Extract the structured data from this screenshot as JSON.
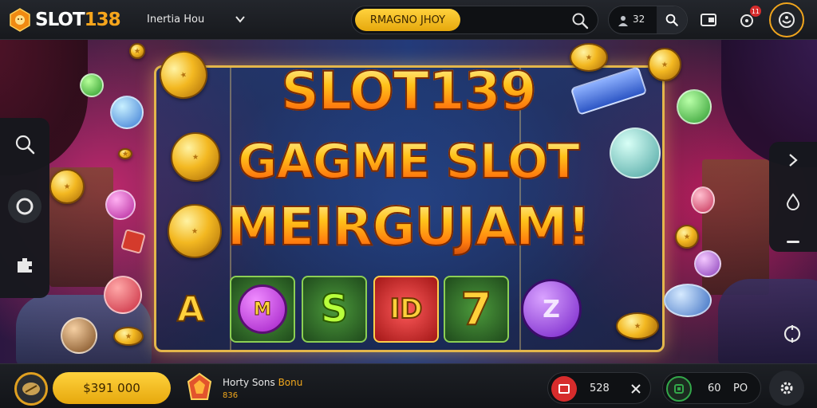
{
  "brand": {
    "logo_text": "SLOT",
    "logo_number": "138"
  },
  "header": {
    "menu_label": "Inertia Hou",
    "search_pill_label": "RMAGNO JHOY",
    "online_count": "32",
    "notification_badge": "11"
  },
  "banner": {
    "line1": "SLOT139",
    "line2": "GAGME SLOT",
    "line3": "MEIRGUJAM!",
    "tiles": [
      "A",
      "M",
      "S",
      "ID",
      "7",
      "Z"
    ]
  },
  "footer": {
    "balance": "$391 000",
    "promo_title": "Horty Sons",
    "promo_accent": "Bonu",
    "promo_sub": "836",
    "stat1_value": "528",
    "stat2_value": "60",
    "stat2_unit": "PO"
  },
  "colors": {
    "accent": "#f0a51d",
    "bar_bg": "#17191d",
    "red": "#d62c2c",
    "green": "#33a84a"
  }
}
